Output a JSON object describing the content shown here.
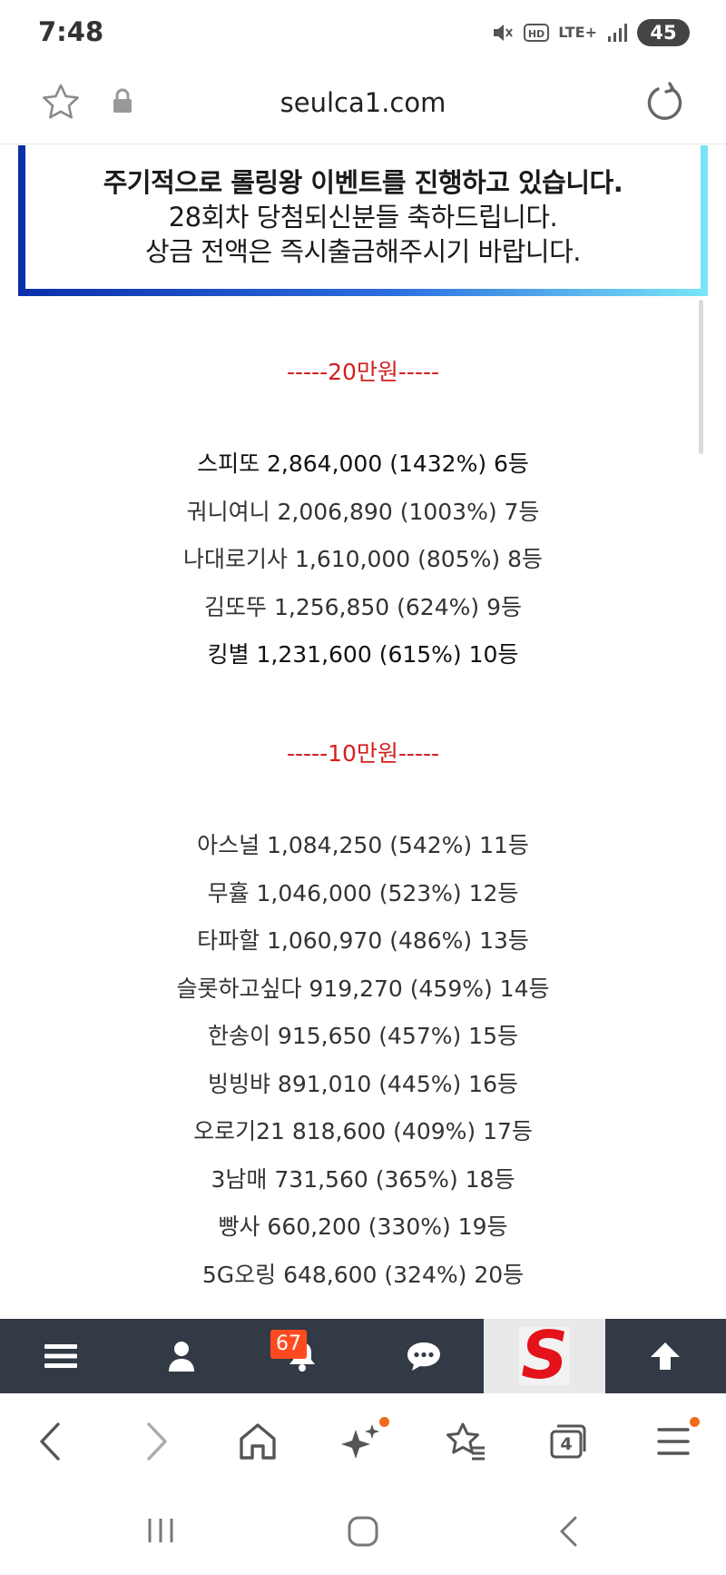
{
  "status_bar": {
    "time": "7:48",
    "network": "LTE+",
    "battery": "45"
  },
  "url_bar": {
    "url": "seulca1.com"
  },
  "banner": {
    "line1": "주기적으로 롤링왕 이벤트를 진행하고 있습니다.",
    "line2": "28회차 당첨되신분들 축하드립니다.",
    "line3": "상금 전액은 즉시출금해주시기 바랍니다."
  },
  "tiers": [
    {
      "header": "-----20만원-----",
      "entries": [
        {
          "text": "스피또 2,864,000 (1432%) 6등"
        },
        {
          "text": "궈니여니 2,006,890 (1003%) 7등"
        },
        {
          "text": "나대로기사 1,610,000 (805%) 8등"
        },
        {
          "text": "김또뚜 1,256,850 (624%) 9등"
        },
        {
          "text": "킹별 1,231,600 (615%) 10등"
        }
      ]
    },
    {
      "header": "-----10만원-----",
      "entries": [
        {
          "text": "아스널 1,084,250 (542%) 11등"
        },
        {
          "text": "무휼 1,046,000 (523%) 12등"
        },
        {
          "text": "타파할 1,060,970 (486%) 13등"
        },
        {
          "text": "슬롯하고싶다 919,270 (459%) 14등"
        },
        {
          "text": "한송이 915,650 (457%) 15등"
        },
        {
          "text": "빙빙뱌 891,010 (445%) 16등"
        },
        {
          "text": "오로기21 818,600 (409%) 17등"
        },
        {
          "text": "3남매 731,560 (365%) 18등"
        },
        {
          "text": "빵사 660,200 (330%) 19등"
        },
        {
          "text": "5G오링 648,600 (324%) 20등"
        }
      ]
    }
  ],
  "site_nav": {
    "notification_count": "67",
    "logo_letter": "S"
  },
  "browser_bar": {
    "tab_count": "4"
  },
  "colors": {
    "header_red": "#d41f1f",
    "nav_bg": "#323a45",
    "badge": "#ff4b1f",
    "accent_dot": "#f26b1d"
  }
}
